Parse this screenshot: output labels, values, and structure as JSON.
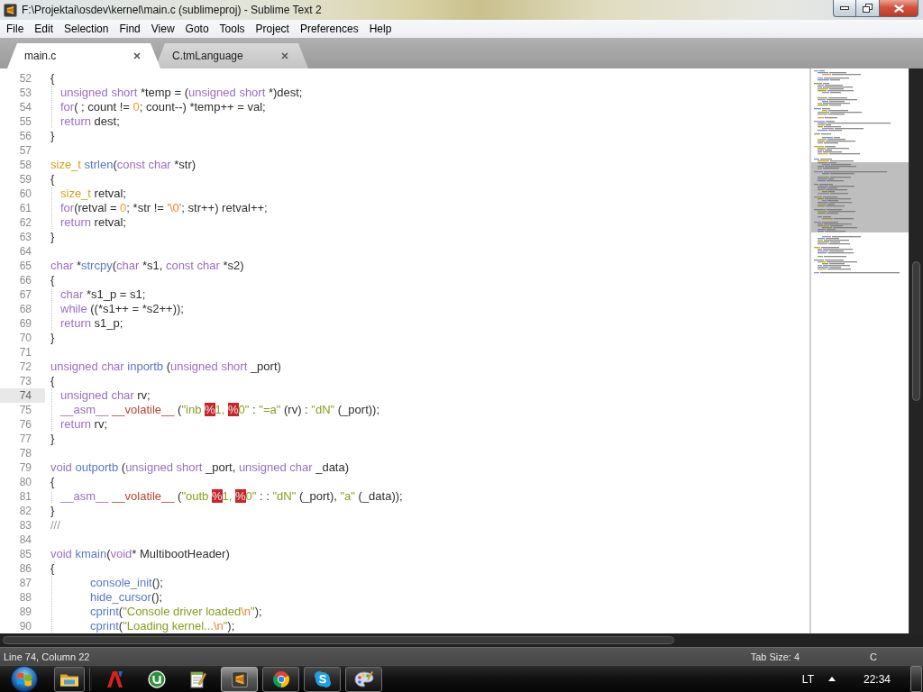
{
  "window": {
    "title": "F:\\Projektai\\osdev\\kernel\\main.c (sublimeproj) - Sublime Text 2"
  },
  "menu": [
    "File",
    "Edit",
    "Selection",
    "Find",
    "View",
    "Goto",
    "Tools",
    "Project",
    "Preferences",
    "Help"
  ],
  "tabs": [
    {
      "label": "main.c",
      "selected": true
    },
    {
      "label": "C.tmLanguage",
      "selected": false
    }
  ],
  "editor": {
    "lines": [
      {
        "number": "52",
        "current": false,
        "tokens": [
          {
            "kind": "plain",
            "text": "{"
          }
        ]
      },
      {
        "number": "53",
        "current": false,
        "tokens": [
          {
            "kind": "keyword",
            "text": "\tunsigned short"
          },
          {
            "kind": "plain",
            "text": " *temp = ("
          },
          {
            "kind": "keyword",
            "text": "unsigned short"
          },
          {
            "kind": "plain",
            "text": " *)dest;"
          }
        ]
      },
      {
        "number": "54",
        "current": false,
        "tokens": [
          {
            "kind": "keyword",
            "text": "\tfor"
          },
          {
            "kind": "plain",
            "text": "( ; count != "
          },
          {
            "kind": "number",
            "text": "0"
          },
          {
            "kind": "plain",
            "text": "; count--) *temp++ = val;"
          }
        ]
      },
      {
        "number": "55",
        "current": false,
        "tokens": [
          {
            "kind": "keyword",
            "text": "\treturn"
          },
          {
            "kind": "plain",
            "text": " dest;"
          }
        ]
      },
      {
        "number": "56",
        "current": false,
        "tokens": [
          {
            "kind": "plain",
            "text": "}"
          }
        ]
      },
      {
        "number": "57",
        "current": false
      },
      {
        "number": "58",
        "current": false,
        "tokens": [
          {
            "kind": "type",
            "text": "size_t"
          },
          {
            "kind": "function",
            "text": " strlen"
          },
          {
            "kind": "plain",
            "text": "("
          },
          {
            "kind": "keyword",
            "text": "const char"
          },
          {
            "kind": "plain",
            "text": " *str)"
          }
        ]
      },
      {
        "number": "59",
        "current": false,
        "tokens": [
          {
            "kind": "plain",
            "text": "{"
          }
        ]
      },
      {
        "number": "60",
        "current": false,
        "tokens": [
          {
            "kind": "type",
            "text": "\tsize_t"
          },
          {
            "kind": "plain",
            "text": " retval;"
          }
        ]
      },
      {
        "number": "61",
        "current": false,
        "tokens": [
          {
            "kind": "keyword",
            "text": "\tfor"
          },
          {
            "kind": "plain",
            "text": "(retval = "
          },
          {
            "kind": "number",
            "text": "0"
          },
          {
            "kind": "plain",
            "text": "; *str != "
          },
          {
            "kind": "string",
            "text": "'"
          },
          {
            "kind": "escape",
            "text": "\\0"
          },
          {
            "kind": "string",
            "text": "'"
          },
          {
            "kind": "plain",
            "text": "; str++) retval++;"
          }
        ]
      },
      {
        "number": "62",
        "current": false,
        "tokens": [
          {
            "kind": "keyword",
            "text": "\treturn"
          },
          {
            "kind": "plain",
            "text": " retval;"
          }
        ]
      },
      {
        "number": "63",
        "current": false,
        "tokens": [
          {
            "kind": "plain",
            "text": "}"
          }
        ]
      },
      {
        "number": "64",
        "current": false
      },
      {
        "number": "65",
        "current": false,
        "tokens": [
          {
            "kind": "keyword",
            "text": "char"
          },
          {
            "kind": "plain",
            "text": " *"
          },
          {
            "kind": "function",
            "text": "strcpy"
          },
          {
            "kind": "plain",
            "text": "("
          },
          {
            "kind": "keyword",
            "text": "char"
          },
          {
            "kind": "plain",
            "text": " *s1, "
          },
          {
            "kind": "keyword",
            "text": "const char"
          },
          {
            "kind": "plain",
            "text": " *s2)"
          }
        ]
      },
      {
        "number": "66",
        "current": false,
        "tokens": [
          {
            "kind": "plain",
            "text": "{"
          }
        ]
      },
      {
        "number": "67",
        "current": false,
        "tokens": [
          {
            "kind": "keyword",
            "text": "\tchar"
          },
          {
            "kind": "plain",
            "text": " *s1_p = s1;"
          }
        ]
      },
      {
        "number": "68",
        "current": false,
        "tokens": [
          {
            "kind": "keyword",
            "text": "\twhile"
          },
          {
            "kind": "plain",
            "text": " ((*s1++ = *s2++));"
          }
        ]
      },
      {
        "number": "69",
        "current": false,
        "tokens": [
          {
            "kind": "keyword",
            "text": "\treturn"
          },
          {
            "kind": "plain",
            "text": " s1_p;"
          }
        ]
      },
      {
        "number": "70",
        "current": false,
        "tokens": [
          {
            "kind": "plain",
            "text": "}"
          }
        ]
      },
      {
        "number": "71",
        "current": false
      },
      {
        "number": "72",
        "current": false,
        "tokens": [
          {
            "kind": "keyword",
            "text": "unsigned char"
          },
          {
            "kind": "function",
            "text": " inportb"
          },
          {
            "kind": "plain",
            "text": " ("
          },
          {
            "kind": "keyword",
            "text": "unsigned short"
          },
          {
            "kind": "plain",
            "text": " _port)"
          }
        ]
      },
      {
        "number": "73",
        "current": false,
        "tokens": [
          {
            "kind": "matched-brace",
            "text": "{"
          }
        ]
      },
      {
        "number": "74",
        "current": true,
        "tokens": [
          {
            "kind": "keyword",
            "text": "\tunsigned char"
          },
          {
            "kind": "plain",
            "text": " rv;"
          }
        ]
      },
      {
        "number": "75",
        "current": false,
        "tokens": [
          {
            "kind": "keyword",
            "text": "\t__asm__"
          },
          {
            "kind": "storage",
            "text": " __volatile__"
          },
          {
            "kind": "plain",
            "text": " ("
          },
          {
            "kind": "string",
            "text": "\"inb "
          },
          {
            "kind": "invalid",
            "text": "%"
          },
          {
            "kind": "string",
            "text": "1, "
          },
          {
            "kind": "invalid",
            "text": "%"
          },
          {
            "kind": "string",
            "text": "0\""
          },
          {
            "kind": "plain",
            "text": " : "
          },
          {
            "kind": "string",
            "text": "\"=a\""
          },
          {
            "kind": "plain",
            "text": " (rv) : "
          },
          {
            "kind": "string",
            "text": "\"dN\""
          },
          {
            "kind": "plain",
            "text": " (_port));"
          }
        ]
      },
      {
        "number": "76",
        "current": false,
        "tokens": [
          {
            "kind": "keyword",
            "text": "\treturn"
          },
          {
            "kind": "plain",
            "text": " rv;"
          }
        ]
      },
      {
        "number": "77",
        "current": false,
        "tokens": [
          {
            "kind": "matched-brace",
            "text": "}"
          }
        ]
      },
      {
        "number": "78",
        "current": false
      },
      {
        "number": "79",
        "current": false,
        "tokens": [
          {
            "kind": "keyword",
            "text": "void"
          },
          {
            "kind": "function",
            "text": " outportb"
          },
          {
            "kind": "plain",
            "text": " ("
          },
          {
            "kind": "keyword",
            "text": "unsigned short"
          },
          {
            "kind": "plain",
            "text": " _port, "
          },
          {
            "kind": "keyword",
            "text": "unsigned char"
          },
          {
            "kind": "plain",
            "text": " _data)"
          }
        ]
      },
      {
        "number": "80",
        "current": false,
        "tokens": [
          {
            "kind": "plain",
            "text": "{"
          }
        ]
      },
      {
        "number": "81",
        "current": false,
        "tokens": [
          {
            "kind": "keyword",
            "text": "\t__asm__"
          },
          {
            "kind": "storage",
            "text": " __volatile__"
          },
          {
            "kind": "plain",
            "text": " ("
          },
          {
            "kind": "string",
            "text": "\"outb "
          },
          {
            "kind": "invalid",
            "text": "%"
          },
          {
            "kind": "string",
            "text": "1, "
          },
          {
            "kind": "invalid",
            "text": "%"
          },
          {
            "kind": "string",
            "text": "0\""
          },
          {
            "kind": "plain",
            "text": " : : "
          },
          {
            "kind": "string",
            "text": "\"dN\""
          },
          {
            "kind": "plain",
            "text": " (_port), "
          },
          {
            "kind": "string",
            "text": "\"a\""
          },
          {
            "kind": "plain",
            "text": " (_data));"
          }
        ]
      },
      {
        "number": "82",
        "current": false,
        "tokens": [
          {
            "kind": "plain",
            "text": "}"
          }
        ]
      },
      {
        "number": "83",
        "current": false,
        "tokens": [
          {
            "kind": "comment",
            "text": "///"
          }
        ]
      },
      {
        "number": "84",
        "current": false
      },
      {
        "number": "85",
        "current": false,
        "tokens": [
          {
            "kind": "keyword",
            "text": "void"
          },
          {
            "kind": "function",
            "text": " kmain"
          },
          {
            "kind": "plain",
            "text": "("
          },
          {
            "kind": "keyword",
            "text": "void"
          },
          {
            "kind": "plain",
            "text": "* MultibootHeader)"
          }
        ]
      },
      {
        "number": "86",
        "current": false,
        "tokens": [
          {
            "kind": "plain",
            "text": "{"
          }
        ]
      },
      {
        "number": "87",
        "current": false,
        "tokens": [
          {
            "kind": "function",
            "text": "\t\t\t\tconsole_init"
          },
          {
            "kind": "plain",
            "text": "();"
          }
        ]
      },
      {
        "number": "88",
        "current": false,
        "tokens": [
          {
            "kind": "function",
            "text": "\t\t\t\thide_cursor"
          },
          {
            "kind": "plain",
            "text": "();"
          }
        ]
      },
      {
        "number": "89",
        "current": false,
        "tokens": [
          {
            "kind": "function",
            "text": "\t\t\t\tcprint"
          },
          {
            "kind": "plain",
            "text": "("
          },
          {
            "kind": "string",
            "text": "\"Console driver loaded"
          },
          {
            "kind": "escape",
            "text": "\\n"
          },
          {
            "kind": "string",
            "text": "\""
          },
          {
            "kind": "plain",
            "text": ");"
          }
        ]
      },
      {
        "number": "90",
        "current": false,
        "tokens": [
          {
            "kind": "function",
            "text": "\t\t\t\tcprint"
          },
          {
            "kind": "plain",
            "text": "("
          },
          {
            "kind": "string",
            "text": "\"Loading kernel..."
          },
          {
            "kind": "escape",
            "text": "\\n"
          },
          {
            "kind": "string",
            "text": "\""
          },
          {
            "kind": "plain",
            "text": ");"
          }
        ]
      }
    ]
  },
  "status_bar": {
    "position": "Line 74, Column 22",
    "tab_size": "Tab Size: 4",
    "syntax": "C"
  },
  "taskbar": {
    "apps": [
      {
        "kind": "folder",
        "running": true,
        "active": false
      },
      {
        "kind": "reader",
        "running": false,
        "active": false
      },
      {
        "kind": "torrent",
        "running": false,
        "active": false
      },
      {
        "kind": "notepad",
        "running": false,
        "active": false
      },
      {
        "kind": "editor",
        "running": true,
        "active": true
      },
      {
        "kind": "browser",
        "running": true,
        "active": false
      },
      {
        "kind": "chat",
        "running": true,
        "active": false
      },
      {
        "kind": "paint",
        "running": true,
        "active": false
      }
    ],
    "language": "LT",
    "clock": "22:34"
  }
}
